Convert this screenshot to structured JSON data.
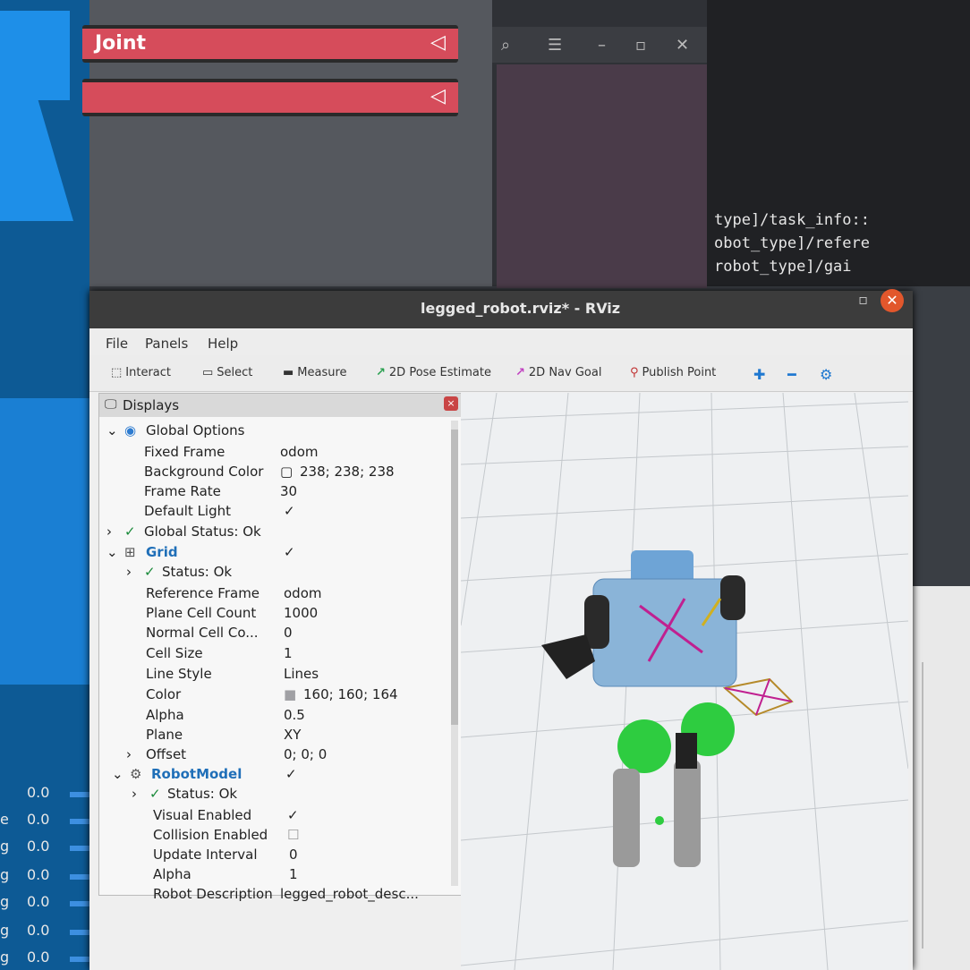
{
  "background_app": {
    "joint_label": "Joint",
    "slider_values": [
      "0.0",
      "0.0",
      "0.0",
      "0.0",
      "0.0",
      "0.0",
      "0.0"
    ],
    "slider_row_prefixes": [
      "",
      "e",
      "g",
      "g",
      "g",
      "g",
      "g"
    ]
  },
  "terminal": {
    "lines": [
      "type]/task_info::",
      "obot_type]/refere",
      "robot_type]/gai"
    ]
  },
  "rviz": {
    "title": "legged_robot.rviz* - RViz",
    "menu": [
      "File",
      "Panels",
      "Help"
    ],
    "toolbar": {
      "interact": "Interact",
      "select": "Select",
      "measure": "Measure",
      "pose_estimate": "2D Pose Estimate",
      "nav_goal": "2D Nav Goal",
      "publish_point": "Publish Point"
    },
    "displays": {
      "title": "Displays",
      "global_options": {
        "label": "Global Options",
        "fixed_frame": {
          "label": "Fixed Frame",
          "value": "odom"
        },
        "background_color": {
          "label": "Background Color",
          "value": "238; 238; 238"
        },
        "frame_rate": {
          "label": "Frame Rate",
          "value": "30"
        },
        "default_light": {
          "label": "Default Light",
          "value": "✓"
        }
      },
      "global_status": "Global Status: Ok",
      "grid": {
        "label": "Grid",
        "enabled": "✓",
        "status": "Status: Ok",
        "reference_frame": {
          "label": "Reference Frame",
          "value": "odom"
        },
        "plane_cell_count": {
          "label": "Plane Cell Count",
          "value": "1000"
        },
        "normal_cell_count": {
          "label": "Normal Cell Co...",
          "value": "0"
        },
        "cell_size": {
          "label": "Cell Size",
          "value": "1"
        },
        "line_style": {
          "label": "Line Style",
          "value": "Lines"
        },
        "color": {
          "label": "Color",
          "value": "160; 160; 164"
        },
        "alpha": {
          "label": "Alpha",
          "value": "0.5"
        },
        "plane": {
          "label": "Plane",
          "value": "XY"
        },
        "offset": {
          "label": "Offset",
          "value": "0; 0; 0"
        }
      },
      "robot_model": {
        "label": "RobotModel",
        "enabled": "✓",
        "status": "Status: Ok",
        "visual_enabled": {
          "label": "Visual Enabled",
          "value": "✓"
        },
        "collision_enabled": {
          "label": "Collision Enabled",
          "value": ""
        },
        "update_interval": {
          "label": "Update Interval",
          "value": "0"
        },
        "alpha": {
          "label": "Alpha",
          "value": "1"
        },
        "robot_description": {
          "label": "Robot Description",
          "value": "legged_robot_desc..."
        }
      }
    }
  },
  "colors": {
    "joint_bar": "#d64c5b",
    "accent_blue": "#1e8fe8",
    "rviz_close": "#e2572c",
    "robot_green": "#2ecc40",
    "robot_body": "#8ab4d8"
  }
}
